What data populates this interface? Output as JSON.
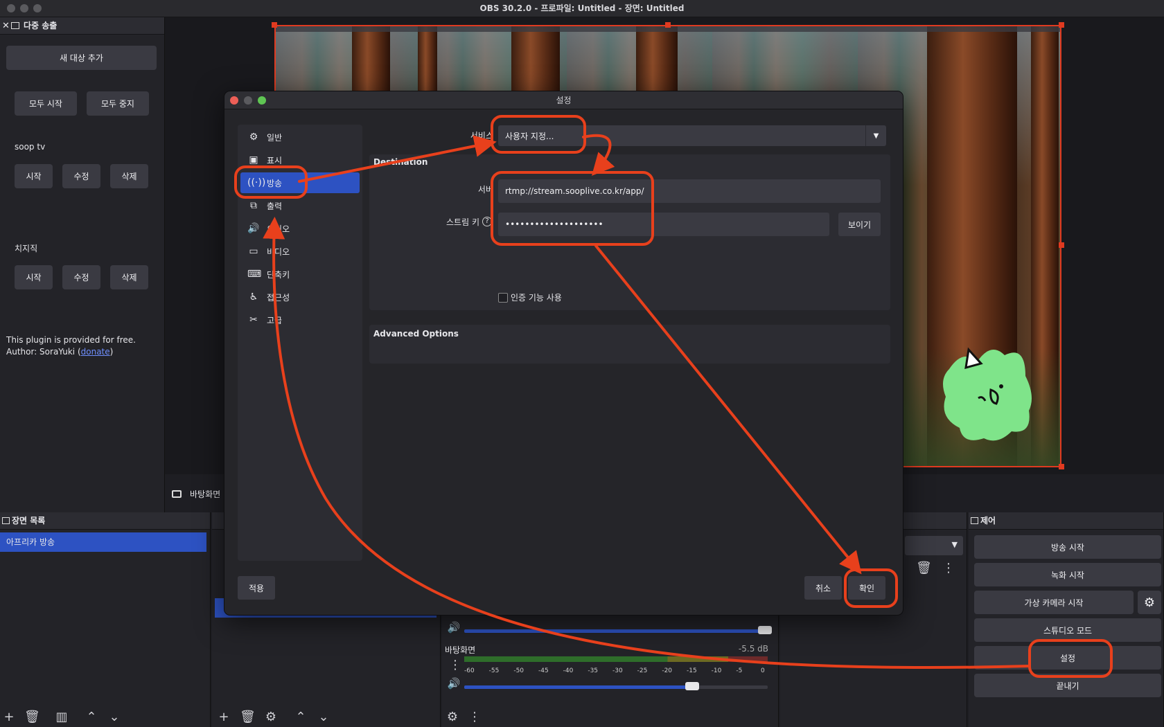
{
  "window": {
    "title": "OBS 30.2.0 - 프로파일: Untitled - 장면: Untitled"
  },
  "multistream": {
    "dock_title": "다중 송출",
    "add_target": "새 대상 추가",
    "start_all": "모두 시작",
    "stop_all": "모두 중지",
    "targets": [
      {
        "name": "soop tv",
        "start": "시작",
        "edit": "수정",
        "delete": "삭제"
      },
      {
        "name": "치지직",
        "start": "시작",
        "edit": "수정",
        "delete": "삭제"
      }
    ],
    "footer_line1": "This plugin is provided for free.",
    "footer_author_prefix": "Author: SoraYuki (",
    "footer_link": "donate",
    "footer_author_suffix": ")"
  },
  "preview": {
    "source_label": "바탕화면"
  },
  "scenes": {
    "dock_title": "장면 목록",
    "items": [
      "아프리카 방송"
    ]
  },
  "audio": {
    "channel_name": "바탕화면",
    "channel_level": "-5.5 dB",
    "meter_ticks": [
      "-60",
      "-55",
      "-50",
      "-45",
      "-40",
      "-35",
      "-30",
      "-25",
      "-20",
      "-15",
      "-10",
      "-5",
      "0"
    ],
    "mic_volume": 1.0,
    "desktop_volume": 0.75
  },
  "controls": {
    "dock_title": "제어",
    "start_stream": "방송 시작",
    "start_record": "녹화 시작",
    "start_virtualcam": "가상 카메라 시작",
    "studio_mode": "스튜디오 모드",
    "settings": "설정",
    "exit": "끝내기"
  },
  "settings_dialog": {
    "title": "설정",
    "sidebar": [
      {
        "label": "일반",
        "icon": "gear-icon"
      },
      {
        "label": "표시",
        "icon": "display-icon"
      },
      {
        "label": "방송",
        "icon": "broadcast-icon"
      },
      {
        "label": "출력",
        "icon": "output-icon"
      },
      {
        "label": "오디오",
        "icon": "speaker-icon"
      },
      {
        "label": "비디오",
        "icon": "monitor-icon"
      },
      {
        "label": "단축키",
        "icon": "keyboard-icon"
      },
      {
        "label": "접근성",
        "icon": "accessibility-icon"
      },
      {
        "label": "고급",
        "icon": "tools-icon"
      }
    ],
    "active_item": "방송",
    "service_label": "서비스",
    "service_value": "사용자 지정...",
    "destination_title": "Destination",
    "server_label": "서버",
    "server_value": "rtmp://stream.sooplive.co.kr/app/",
    "stream_key_label": "스트림 키",
    "stream_key_value": "••••••••••••••••••••",
    "show_button": "보이기",
    "auth_checkbox": "인증 기능 사용",
    "advanced_title": "Advanced Options",
    "apply": "적용",
    "cancel": "취소",
    "ok": "확인"
  },
  "colors": {
    "accent": "#2d52c2",
    "annotation": "#e8401c",
    "selection_border": "#e03a20"
  }
}
